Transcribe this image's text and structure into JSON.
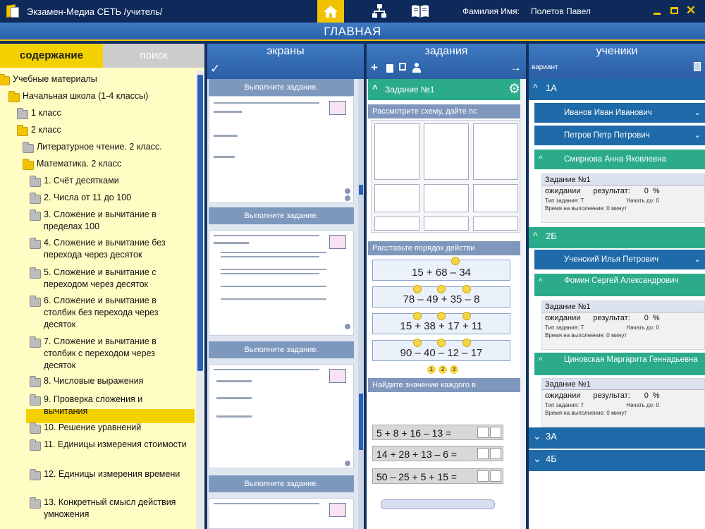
{
  "window": {
    "title": "Экзамен-Медиа СЕТЬ /учитель/",
    "user_label": "Фамилия Имя:",
    "user_name": "Полетов Павел",
    "nav_icons": [
      "home-icon",
      "network-icon",
      "book-icon"
    ],
    "window_controls": [
      "minimize-icon",
      "maximize-icon",
      "close-icon"
    ]
  },
  "header": {
    "title": "ГЛАВНАЯ"
  },
  "left": {
    "tabs": [
      {
        "label": "содержание",
        "active": true
      },
      {
        "label": "поиск",
        "active": false
      }
    ],
    "tree": [
      {
        "label": "Учебные материалы",
        "icon": "folder-yellow"
      },
      {
        "label": "Начальная школа (1-4 классы)",
        "icon": "folder-yellow"
      },
      {
        "label": "1 класс",
        "icon": "folder-gray"
      },
      {
        "label": "2 класс",
        "icon": "folder-yellow"
      },
      {
        "label": "Литературное чтение. 2 класс.",
        "icon": "folder-gray"
      },
      {
        "label": "Математика. 2 класс",
        "icon": "folder-yellow"
      },
      {
        "label": "1. Счёт десятками",
        "icon": "folder-gray"
      },
      {
        "label": "2. Числа от 11 до 100",
        "icon": "folder-gray"
      },
      {
        "label": "3. Сложение и вычитание в пределах 100",
        "icon": "folder-gray"
      },
      {
        "label": "4. Сложение и вычитание без перехода через десяток",
        "icon": "folder-gray"
      },
      {
        "label": "5. Сложение и вычитание с переходом через десяток",
        "icon": "folder-gray"
      },
      {
        "label": "6. Сложение и вычитание в столбик без перехода через десяток",
        "icon": "folder-gray"
      },
      {
        "label": "7. Сложение и вычитание в столбик с переходом через десяток",
        "icon": "folder-gray"
      },
      {
        "label": "8. Числовые выражения",
        "icon": "folder-gray",
        "selected": true
      },
      {
        "label": "9. Проверка сложения и вычитания",
        "icon": "folder-gray"
      },
      {
        "label": "10. Решение уравнений",
        "icon": "folder-gray"
      },
      {
        "label": "11. Единицы измерения стоимости",
        "icon": "folder-gray"
      },
      {
        "label": "12. Единицы измерения времени",
        "icon": "folder-gray"
      },
      {
        "label": "13. Конкретный смысл действия умножения",
        "icon": "folder-gray"
      }
    ]
  },
  "screens": {
    "title": "экраны",
    "check_icon": "check-icon",
    "cards": [
      {
        "header": "Выполните задание."
      },
      {
        "header": "Выполните задание."
      },
      {
        "header": "Выполните задание."
      },
      {
        "header": "Выполните задание."
      }
    ]
  },
  "tasks": {
    "title": "задания",
    "toolbar_icons": [
      "add-icon",
      "delete-icon",
      "copy-icon",
      "users-icon",
      "arrow-right-icon"
    ],
    "task_header": "Задание №1",
    "blocks": [
      "Рассмотрите схему, дайте пс",
      "Расставьте порядок действи",
      "Найдите значение каждого в"
    ],
    "expressions": [
      "15 + 68 – 34",
      "78 – 49 + 35 – 8",
      "15 + 38 + 17 + 11",
      "90 – 40 – 12 – 17"
    ],
    "order_labels": [
      "1",
      "2",
      "3"
    ],
    "equations": [
      "5 + 8 + 16 – 13 =",
      "14 + 28 + 13 – 6 =",
      "50 – 25 + 5 + 15 ="
    ]
  },
  "students": {
    "title": "ученики",
    "variant_label": "вариант",
    "classes": [
      {
        "name": "1А",
        "students": [
          {
            "name": "Иванов Иван Иванович"
          },
          {
            "name": "Петров Петр Петрович"
          },
          {
            "name": "Смирнова Анна Яковлевна"
          }
        ]
      },
      {
        "name": "2Б",
        "students": [
          {
            "name": "Ученский Илья Петрович"
          },
          {
            "name": "Фомин Сергей Александрович"
          },
          {
            "name": "Циновская Маргарита Геннадьевна"
          }
        ]
      },
      {
        "name": "3А"
      },
      {
        "name": "4Б"
      }
    ],
    "task_box": {
      "title": "Задание №1",
      "status": "ожидании",
      "result_label": "результат:",
      "result_value": "0",
      "percent": "%",
      "type_label": "Тип задания: Т",
      "start_label": "Начать до: 0",
      "time_label": "Время на выполнение: 0 минут"
    }
  },
  "colors": {
    "accent": "#f3d100",
    "blue": "#1f6aa8",
    "teal": "#2bab8a",
    "title_bg": "#0e2a5a"
  }
}
